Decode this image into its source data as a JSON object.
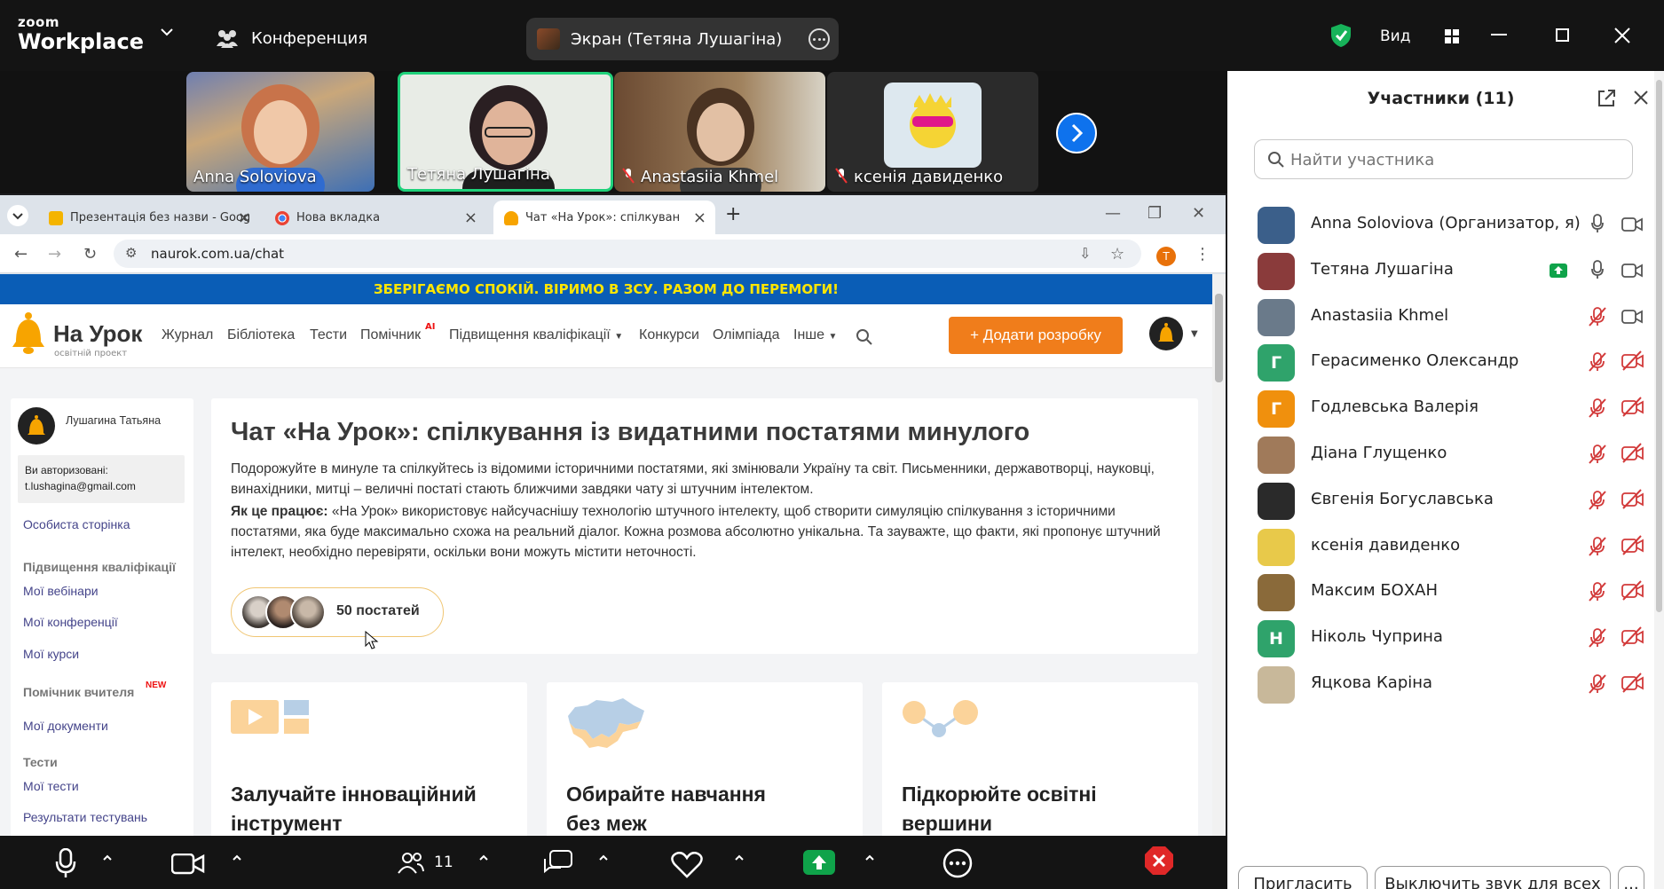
{
  "zoom": {
    "logo_line1": "zoom",
    "logo_line2": "Workplace",
    "conference_label": "Конференция",
    "screen_share_label": "Экран (Тетяна Лушагіна)",
    "view_label": "Вид"
  },
  "video_strip": [
    {
      "name": "Anna Soloviova",
      "muted": false,
      "active": false
    },
    {
      "name": "Тетяна Лушагіна",
      "muted": false,
      "active": true
    },
    {
      "name": "Anastasiia Khmel",
      "muted": true,
      "active": false
    },
    {
      "name": "ксенія давиденко",
      "muted": true,
      "active": false
    }
  ],
  "browser": {
    "tabs": [
      {
        "title": "Презентація без назви - Goog",
        "active": false
      },
      {
        "title": "Нова вкладка",
        "active": false
      },
      {
        "title": "Чат «На Урок»: спілкування із",
        "active": true
      }
    ],
    "url": "naurok.com.ua/chat",
    "profile_initial": "T"
  },
  "site": {
    "banner": "ЗБЕРІГАЄМО СПОКІЙ. ВІРИМО В ЗСУ. РАЗОМ ДО ПЕРЕМОГИ!",
    "logo_title": "На Урок",
    "logo_sub": "освітній проект",
    "nav": {
      "journal": "Журнал",
      "library": "Бібліотека",
      "tests": "Тести",
      "assistant": "Помічник",
      "ai_badge": "AI",
      "qualification": "Підвищення кваліфікації",
      "contests": "Конкурси",
      "olympiad": "Олімпіада",
      "other": "Інше"
    },
    "add_button": "+ Додати розробку",
    "sidebar": {
      "user_name": "Лушагина Татьяна",
      "auth_label": "Ви авторизовані:",
      "auth_email": "t.lushagina@gmail.com",
      "personal_page": "Особиста сторінка",
      "qualification_head": "Підвищення кваліфікації",
      "webinars": "Мої вебінари",
      "conferences": "Мої конференції",
      "courses": "Мої курси",
      "assistant_head": "Помічник вчителя",
      "new_badge": "NEW",
      "documents": "Мої документи",
      "tests_head": "Тести",
      "my_tests": "Мої тести",
      "test_results": "Результати тестувань"
    },
    "hero": {
      "title": "Чат «На Урок»: спілкування із видатними постатями минулого",
      "p1": "Подорожуйте в минуле та спілкуйтесь із відомими історичними постатями, які змінювали Україну та світ. Письменники, державотворці, науковці, винахідники, митці – величні постаті стають ближчими завдяки чату зі штучним інтелектом.",
      "p2_bold": "Як це працює:",
      "p2": " «На Урок» використовує найсучаснішу технологію штучного інтелекту, щоб створити симуляцію спілкування з історичними постатями, яка буде максимально схожа на реальний діалог. Кожна розмова абсолютно унікальна. Та зауважте, що факти, які пропонує штучний інтелект, необхідно перевіряти, оскільки вони можуть містити неточності.",
      "figures_label": "50 постатей"
    },
    "features": [
      {
        "title": "Залучайте інноваційний інструмент"
      },
      {
        "title": "Обирайте навчання без меж"
      },
      {
        "title": "Підкорюйте освітні вершини"
      }
    ]
  },
  "participants": {
    "title": "Участники (11)",
    "search_placeholder": "Найти участника",
    "list": [
      {
        "name": "Anna Soloviova (Организатор, я)",
        "initial": "",
        "color": "#3b5f8a",
        "mic": "on",
        "video": "on",
        "share": false
      },
      {
        "name": "Тетяна Лушагіна",
        "initial": "",
        "color": "#8a3b3b",
        "mic": "on",
        "video": "on",
        "share": true
      },
      {
        "name": "Anastasiia Khmel",
        "initial": "",
        "color": "#6a7a8a",
        "mic": "off",
        "video": "on",
        "share": false
      },
      {
        "name": "Герасименко Олександр",
        "initial": "Г",
        "color": "#2fa36b",
        "mic": "off",
        "video": "off",
        "share": false
      },
      {
        "name": "Годлевська Валерія",
        "initial": "Г",
        "color": "#f0900d",
        "mic": "off",
        "video": "off",
        "share": false
      },
      {
        "name": "Діана Глущенко",
        "initial": "",
        "color": "#a07a5a",
        "mic": "off",
        "video": "off",
        "share": false
      },
      {
        "name": "Євгенія Богуславська",
        "initial": "",
        "color": "#2a2a2a",
        "mic": "off",
        "video": "off",
        "share": false
      },
      {
        "name": "ксенія давиденко",
        "initial": "",
        "color": "#e8c94a",
        "mic": "off",
        "video": "off",
        "share": false
      },
      {
        "name": "Максим БОХАН",
        "initial": "",
        "color": "#8a6a3a",
        "mic": "off",
        "video": "off",
        "share": false
      },
      {
        "name": "Ніколь Чуприна",
        "initial": "Н",
        "color": "#2fa36b",
        "mic": "off",
        "video": "off",
        "share": false
      },
      {
        "name": "Яцкова Каріна",
        "initial": "",
        "color": "#c8b89a",
        "mic": "off",
        "video": "off",
        "share": false
      }
    ],
    "invite_button": "Пригласить",
    "mute_all_button": "Выключить звук для всех",
    "more_button": "..."
  },
  "toolbar": {
    "participant_count": "11"
  },
  "colors": {
    "zoom_blue": "#0e72ed",
    "share_green": "#0fa34a",
    "mute_red": "#d23a3a",
    "naurok_orange": "#f07d1b",
    "banner_blue": "#0a5db6",
    "banner_yellow": "#ffe600"
  }
}
